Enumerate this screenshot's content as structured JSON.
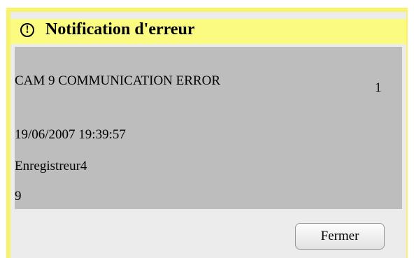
{
  "dialog": {
    "title": "Notification d'erreur",
    "icon": "warning-circle-icon",
    "colors": {
      "frame": "#f7f36b",
      "titlebar": "#fbfb82",
      "panel": "#ececec",
      "content": "#bdbdbd"
    }
  },
  "notification": {
    "message": "CAM 9 COMMUNICATION ERROR",
    "count": "1",
    "datetime": "19/06/2007 19:39:57",
    "recorder": "Enregistreur4",
    "channel": "9"
  },
  "actions": {
    "close_label": "Fermer"
  }
}
